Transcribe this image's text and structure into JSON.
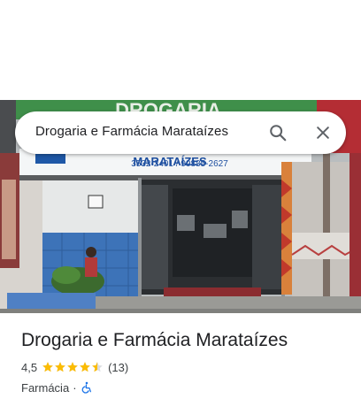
{
  "search": {
    "query": "Drogaria e Farmácia Marataízes"
  },
  "photo": {
    "store_sign": "DROGARIA",
    "store_name_fragment": "MARATAÍZES",
    "phones": "3532-2401 / 99885-2627"
  },
  "place": {
    "name": "Drogaria e Farmácia Marataízes",
    "rating": "4,5",
    "stars_filled": 4.5,
    "reviews": "(13)",
    "category": "Farmácia",
    "separator": "·"
  },
  "icons": {
    "search": "search-icon",
    "close": "close-icon",
    "accessibility": "wheelchair-accessible-icon",
    "star": "star-icon"
  },
  "colors": {
    "star": "#fbbc04",
    "accessibility": "#1a73e8",
    "title": "#202124"
  }
}
